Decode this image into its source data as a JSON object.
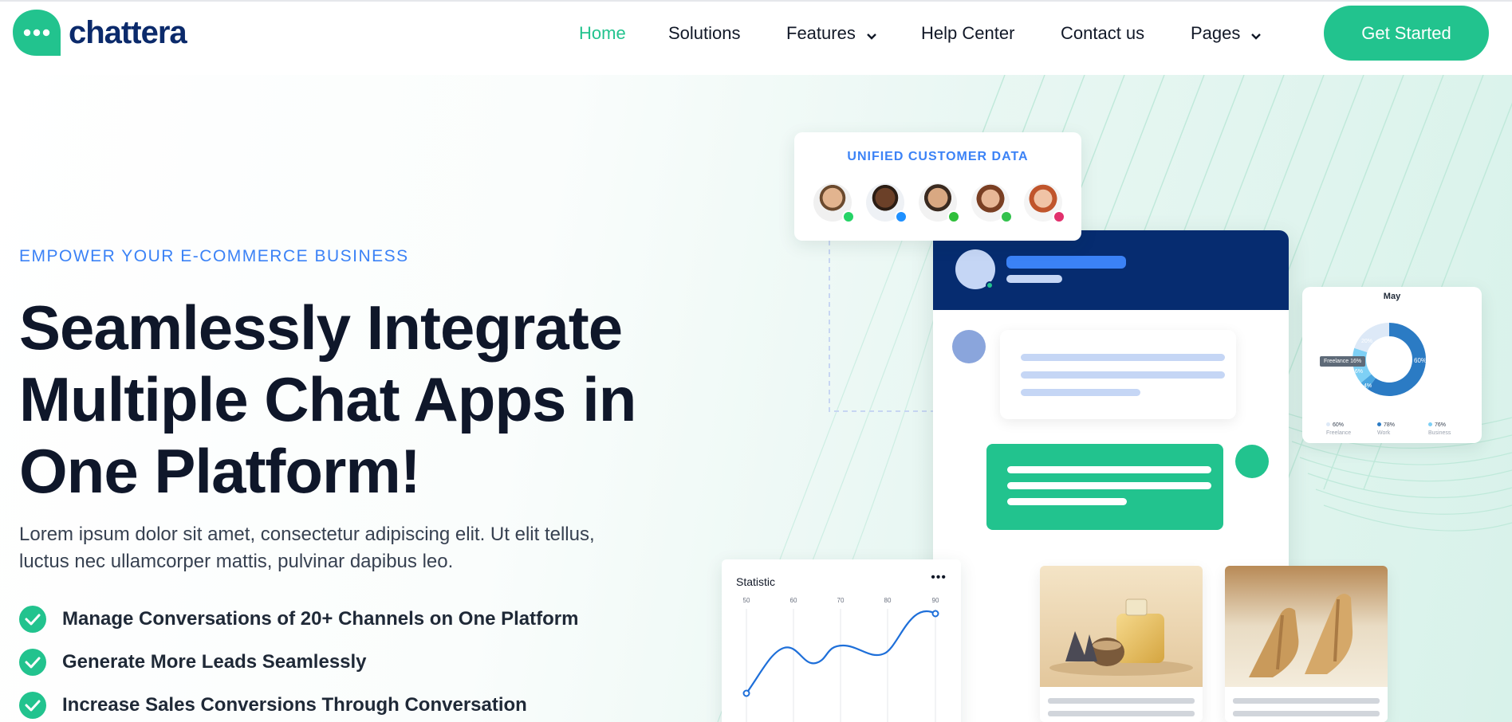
{
  "brand": {
    "name": "chattera",
    "color": "#22c38e",
    "navy": "#0b2a6b"
  },
  "nav": {
    "items": [
      {
        "label": "Home",
        "active": true,
        "dropdown": false
      },
      {
        "label": "Solutions",
        "active": false,
        "dropdown": false
      },
      {
        "label": "Features",
        "active": false,
        "dropdown": true
      },
      {
        "label": "Help Center",
        "active": false,
        "dropdown": false
      },
      {
        "label": "Contact us",
        "active": false,
        "dropdown": false
      },
      {
        "label": "Pages",
        "active": false,
        "dropdown": true
      }
    ],
    "cta": "Get Started"
  },
  "hero": {
    "eyebrow": "EMPOWER YOUR E-COMMERCE BUSINESS",
    "headline": [
      "Seamlessly Integrate",
      "Multiple Chat Apps in",
      "One Platform!"
    ],
    "lead": "Lorem ipsum dolor sit amet, consectetur adipiscing elit. Ut elit tellus, luctus nec ullamcorper mattis, pulvinar dapibus leo.",
    "bullets": [
      "Manage Conversations of 20+ Channels on One Platform",
      "Generate More Leads Seamlessly",
      "Increase Sales Conversions Through Conversation"
    ]
  },
  "unified_card": {
    "title": "UNIFIED CUSTOMER DATA",
    "channels": [
      "whatsapp-icon",
      "messenger-icon",
      "line-icon",
      "wechat-icon",
      "instagram-icon"
    ]
  },
  "donut_card": {
    "title": "May",
    "slices": [
      {
        "label": "60%",
        "value": 60,
        "color": "#2b7bc4"
      },
      {
        "label": "4%",
        "value": 4,
        "color": "#4aa6e0"
      },
      {
        "label": "16%",
        "value": 16,
        "color": "#7ed0f5"
      },
      {
        "label": "20%",
        "value": 20,
        "color": "#dde9f7"
      }
    ],
    "tooltip": "Freelance 16%",
    "legend": [
      {
        "dot": "60%",
        "label": "Freelance",
        "color": "#dde9f7"
      },
      {
        "dot": "78%",
        "label": "Work",
        "color": "#2b7bc4"
      },
      {
        "dot": "76%",
        "label": "Business",
        "color": "#7ed0f5"
      }
    ]
  },
  "statistic_card": {
    "title": "Statistic",
    "menu": "•••",
    "ticks": [
      "50",
      "60",
      "70",
      "80",
      "90"
    ]
  }
}
